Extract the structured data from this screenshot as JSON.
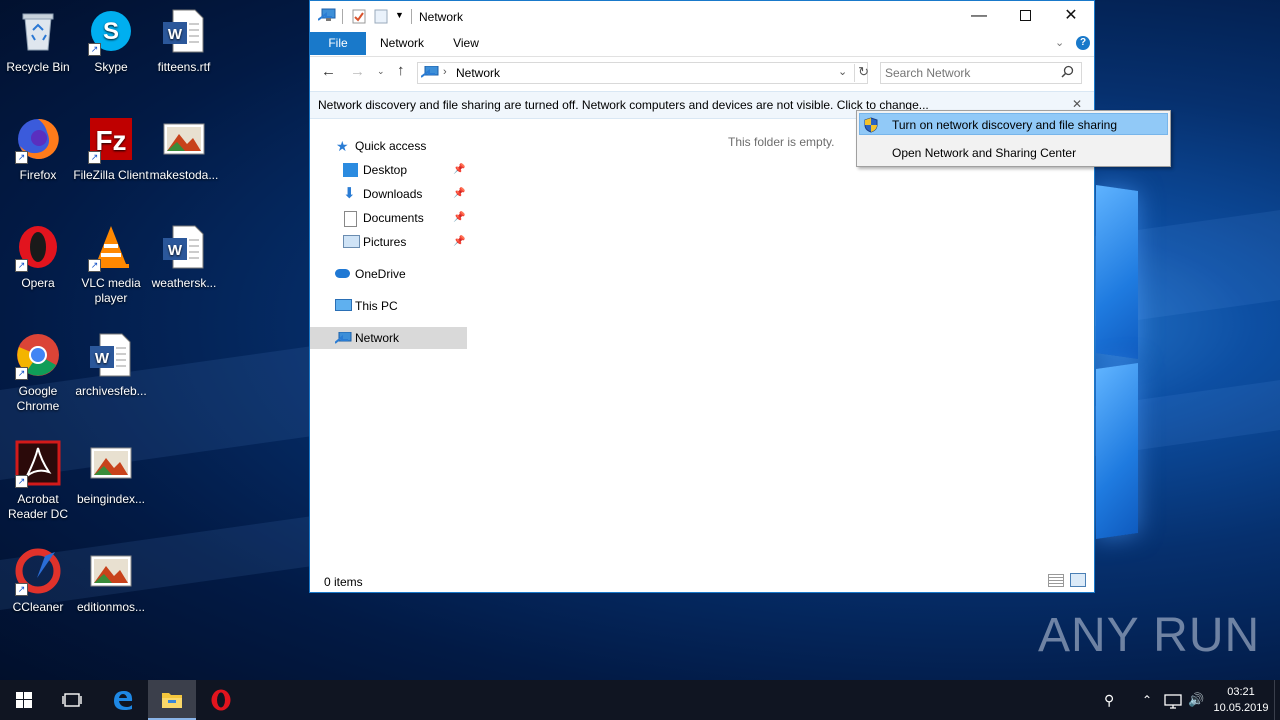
{
  "desktop": {
    "icons": [
      {
        "label": "Recycle Bin",
        "icon": "recycle-bin-icon"
      },
      {
        "label": "Skype",
        "icon": "skype-icon"
      },
      {
        "label": "fitteens.rtf",
        "icon": "word-document-icon"
      },
      {
        "label": "Firefox",
        "icon": "firefox-icon"
      },
      {
        "label": "FileZilla Client",
        "icon": "filezilla-icon"
      },
      {
        "label": "makestoda...",
        "icon": "image-file-icon"
      },
      {
        "label": "Opera",
        "icon": "opera-icon"
      },
      {
        "label": "VLC media player",
        "icon": "vlc-icon"
      },
      {
        "label": "weathersk...",
        "icon": "word-document-icon"
      },
      {
        "label": "Google Chrome",
        "icon": "chrome-icon"
      },
      {
        "label": "archivesfeb...",
        "icon": "word-document-icon"
      },
      {
        "label": "Acrobat Reader DC",
        "icon": "acrobat-icon"
      },
      {
        "label": "beingindex...",
        "icon": "image-file-icon"
      },
      {
        "label": "CCleaner",
        "icon": "ccleaner-icon"
      },
      {
        "label": "editionmos...",
        "icon": "image-file-icon"
      }
    ],
    "watermark": "ANY RUN"
  },
  "explorer": {
    "title": "Network",
    "tabs": {
      "file": "File",
      "network": "Network",
      "view": "View"
    },
    "address": {
      "location": "Network"
    },
    "search": {
      "placeholder": "Search Network"
    },
    "infobar": "Network discovery and file sharing are turned off. Network computers and devices are not visible. Click to change...",
    "nav": {
      "quick_access": "Quick access",
      "desktop": "Desktop",
      "downloads": "Downloads",
      "documents": "Documents",
      "pictures": "Pictures",
      "onedrive": "OneDrive",
      "this_pc": "This PC",
      "network": "Network"
    },
    "empty_message": "This folder is empty.",
    "status": "0 items"
  },
  "context_menu": {
    "items": [
      "Turn on network discovery and file sharing",
      "Open Network and Sharing Center"
    ]
  },
  "taskbar": {
    "time": "03:21",
    "date": "10.05.2019"
  },
  "colors": {
    "accent": "#1979ca",
    "menu_highlight": "#91c9f7",
    "taskbar": "#101522"
  }
}
